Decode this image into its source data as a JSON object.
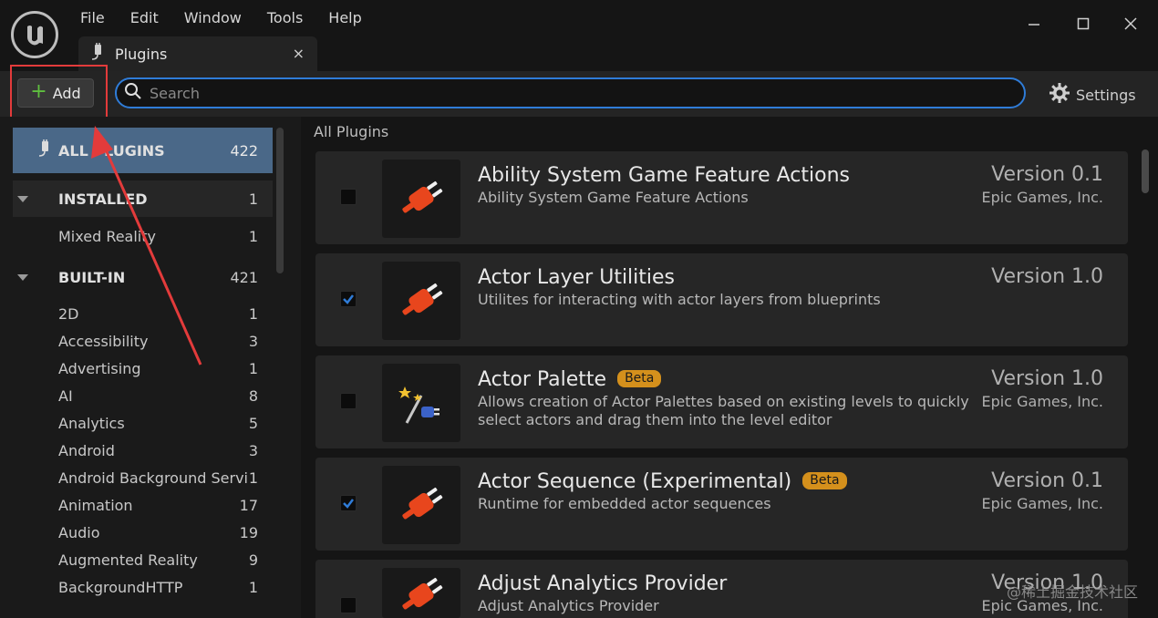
{
  "menu": [
    "File",
    "Edit",
    "Window",
    "Tools",
    "Help"
  ],
  "tab": {
    "label": "Plugins",
    "close": "×"
  },
  "toolbar": {
    "add_label": "Add",
    "search_placeholder": "Search",
    "settings_label": "Settings"
  },
  "sidebar": {
    "all": {
      "label": "ALL PLUGINS",
      "count": "422"
    },
    "installed": {
      "label": "INSTALLED",
      "count": "1"
    },
    "installed_items": [
      {
        "label": "Mixed Reality",
        "count": "1"
      }
    ],
    "builtin": {
      "label": "BUILT-IN",
      "count": "421"
    },
    "builtin_items": [
      {
        "label": "2D",
        "count": "1"
      },
      {
        "label": "Accessibility",
        "count": "3"
      },
      {
        "label": "Advertising",
        "count": "1"
      },
      {
        "label": "AI",
        "count": "8"
      },
      {
        "label": "Analytics",
        "count": "5"
      },
      {
        "label": "Android",
        "count": "3"
      },
      {
        "label": "Android Background Servic",
        "count": "1"
      },
      {
        "label": "Animation",
        "count": "17"
      },
      {
        "label": "Audio",
        "count": "19"
      },
      {
        "label": "Augmented Reality",
        "count": "9"
      },
      {
        "label": "BackgroundHTTP",
        "count": "1"
      }
    ]
  },
  "main": {
    "title": "All Plugins",
    "plugins": [
      {
        "name": "Ability System Game Feature Actions",
        "desc": "Ability System Game Feature Actions",
        "version": "Version 0.1",
        "publisher": "Epic Games, Inc.",
        "checked": false,
        "beta": ""
      },
      {
        "name": "Actor Layer Utilities",
        "desc": "Utilites for interacting with actor layers from blueprints",
        "version": "Version 1.0",
        "publisher": "",
        "checked": true,
        "beta": ""
      },
      {
        "name": "Actor Palette",
        "desc": "Allows creation of Actor Palettes based on existing levels to quickly select actors and drag them into the level editor",
        "version": "Version 1.0",
        "publisher": "Epic Games, Inc.",
        "checked": false,
        "beta": "Beta"
      },
      {
        "name": "Actor Sequence (Experimental)",
        "desc": "Runtime for embedded actor sequences",
        "version": "Version 0.1",
        "publisher": "Epic Games, Inc.",
        "checked": true,
        "beta": "Beta"
      },
      {
        "name": "Adjust Analytics Provider",
        "desc": "Adjust Analytics Provider",
        "version": "Version 1.0",
        "publisher": "Epic Games, Inc.",
        "checked": false,
        "beta": ""
      }
    ]
  },
  "watermark": "@稀土掘金技术社区",
  "colors": {
    "accent": "#2f7cd8",
    "selected": "#4a6888",
    "beta": "#d4901c",
    "plug": "#e8461d",
    "highlight": "#e33b3b"
  }
}
